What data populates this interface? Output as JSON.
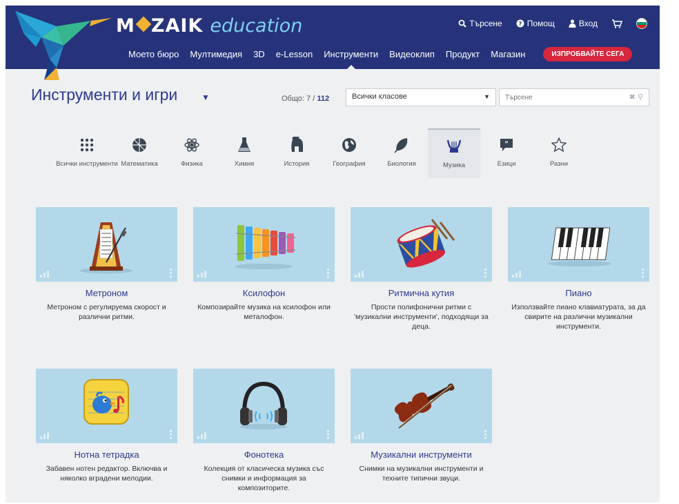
{
  "header": {
    "brand": "M",
    "brand_rest": "ZAIK",
    "brand_sub": "education",
    "top_links": [
      {
        "label": "Търсене",
        "icon": "search-icon"
      },
      {
        "label": "Помощ",
        "icon": "help-icon"
      },
      {
        "label": "Вход",
        "icon": "user-icon"
      }
    ],
    "nav": [
      "Моето бюро",
      "Мултимедия",
      "3D",
      "e-Lesson",
      "Инструменти",
      "Видеоклип",
      "Продукт",
      "Магазин"
    ],
    "active_nav": "Инструменти",
    "try_button": "ИЗПРОБВАЙТЕ СЕГА",
    "colors": {
      "header_bg": "#26337a",
      "accent": "#d7263d",
      "logo_diamond": "#f2b233",
      "edu": "#7fd0f0"
    }
  },
  "toolbar": {
    "title": "Инструменти и игри",
    "total_label": "Общо: 7 /",
    "total_count": "112",
    "grade_select": "Всички класове",
    "search_placeholder": "Търсене"
  },
  "categories": [
    {
      "label": "Всички инструменти",
      "icon": "grid-icon"
    },
    {
      "label": "Математика",
      "icon": "dice-icon"
    },
    {
      "label": "Физика",
      "icon": "atom-icon"
    },
    {
      "label": "Химия",
      "icon": "flask-icon"
    },
    {
      "label": "История",
      "icon": "helmet-icon"
    },
    {
      "label": "География",
      "icon": "globe-icon"
    },
    {
      "label": "Биология",
      "icon": "leaf-icon"
    },
    {
      "label": "Музика",
      "icon": "lyre-icon",
      "active": true
    },
    {
      "label": "Езици",
      "icon": "speech-bubble-icon"
    },
    {
      "label": "Разни",
      "icon": "star-icon"
    }
  ],
  "cards": [
    {
      "title": "Метроном",
      "desc": "Метроном с регулируема скорост и различни ритми.",
      "icon": "metronome-icon"
    },
    {
      "title": "Ксилофон",
      "desc": "Композирайте музика на ксилофон или металофон.",
      "icon": "xylophone-icon"
    },
    {
      "title": "Ритмична кутия",
      "desc": "Прости полифонични ритми с 'музикални инструменти', подходящи за деца.",
      "icon": "drum-icon"
    },
    {
      "title": "Пиано",
      "desc": "Използвайте пиано клавиатурата, за да свирите на различни музикални инструменти.",
      "icon": "piano-icon"
    },
    {
      "title": "Нотна тетрадка",
      "desc": "Забавен нотен редактор. Включва и няколко вградени мелодии.",
      "icon": "songbird-icon"
    },
    {
      "title": "Фонотека",
      "desc": "Колекция от класическа музика със снимки и информация за композиторите.",
      "icon": "headphones-icon"
    },
    {
      "title": "Музикални инструменти",
      "desc": "Снимки на музикални инструменти и техните типични звуци.",
      "icon": "violin-icon"
    }
  ]
}
